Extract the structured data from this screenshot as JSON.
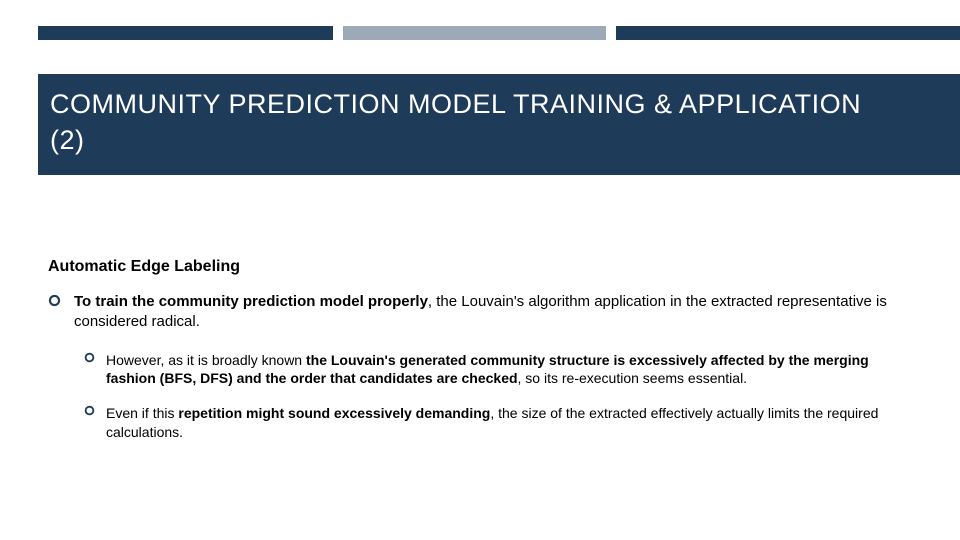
{
  "header": {
    "title_line1": "COMMUNITY PREDICTION MODEL TRAINING & APPLICATION",
    "title_line2": "(2)"
  },
  "section_heading": "Automatic Edge Labeling",
  "bullets": {
    "main": {
      "bold": "To train the community prediction model properly",
      "rest": ", the Louvain's algorithm application in the extracted representative is considered radical."
    },
    "sub": [
      {
        "pre": "However, as it is broadly known ",
        "bold": "the Louvain's generated community structure is excessively affected by the merging fashion (BFS, DFS) and the order that candidates are checked",
        "post": ", so its re-execution seems essential."
      },
      {
        "pre": "Even if this ",
        "bold": "repetition might sound excessively demanding",
        "post": ", the size of the extracted effectively actually limits the required calculations."
      }
    ]
  },
  "colors": {
    "brand_dark": "#1f3b5a",
    "brand_light": "#9ea9b7"
  }
}
